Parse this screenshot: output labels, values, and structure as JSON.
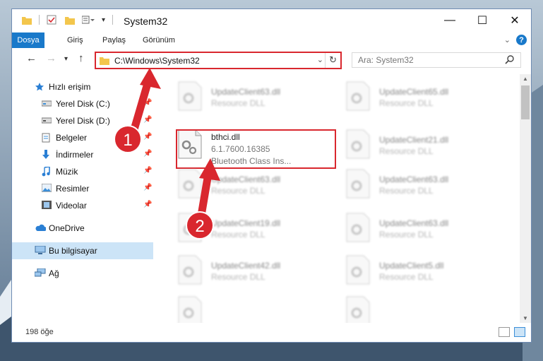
{
  "window": {
    "title": "System32",
    "minimize": "—",
    "maximize": "☐",
    "close": "✕"
  },
  "ribbon": {
    "tabs": [
      {
        "label": "Dosya",
        "active": true
      },
      {
        "label": "Giriş"
      },
      {
        "label": "Paylaş"
      },
      {
        "label": "Görünüm"
      }
    ]
  },
  "address": {
    "path": "C:\\Windows\\System32",
    "search_placeholder": "Ara: System32"
  },
  "nav": {
    "items": [
      {
        "label": "Hızlı erişim",
        "icon": "star-icon"
      },
      {
        "label": "Yerel Disk (C:)",
        "icon": "drive-icon",
        "pinned": true
      },
      {
        "label": "Yerel Disk (D:)",
        "icon": "drive-icon",
        "pinned": true
      },
      {
        "label": "Belgeler",
        "icon": "documents-icon",
        "pinned": true
      },
      {
        "label": "İndirmeler",
        "icon": "downloads-icon",
        "pinned": true
      },
      {
        "label": "Müzik",
        "icon": "music-icon",
        "pinned": true
      },
      {
        "label": "Resimler",
        "icon": "pictures-icon",
        "pinned": true
      },
      {
        "label": "Videolar",
        "icon": "videos-icon",
        "pinned": true
      },
      {
        "label": "OneDrive",
        "icon": "onedrive-icon"
      },
      {
        "label": "Bu bilgisayar",
        "icon": "computer-icon",
        "selected": true
      },
      {
        "label": "Ağ",
        "icon": "network-icon"
      }
    ]
  },
  "files": {
    "highlighted": {
      "name": "bthci.dll",
      "version": "6.1.7600.16385",
      "description": "Bluetooth Class Ins..."
    },
    "blurred_type": "Resource DLL",
    "blurred_left": [
      "UpdateClient63.dll",
      "UpdateClient63.dll",
      "UpdateClient19.dll",
      "UpdateClient42.dll"
    ],
    "blurred_right": [
      "UpdateClient65.dll",
      "UpdateClient21.dll",
      "UpdateClient63.dll",
      "UpdateClient63.dll",
      "UpdateClient5.dll"
    ],
    "blurred_top_left": "UpdateClient63.dll"
  },
  "status": {
    "count": "198 öğe"
  },
  "callouts": {
    "one": "1",
    "two": "2",
    "color": "#d9272e"
  },
  "colors": {
    "accent": "#1979ca",
    "highlight": "#d9272e",
    "selection": "#cce4f7"
  }
}
